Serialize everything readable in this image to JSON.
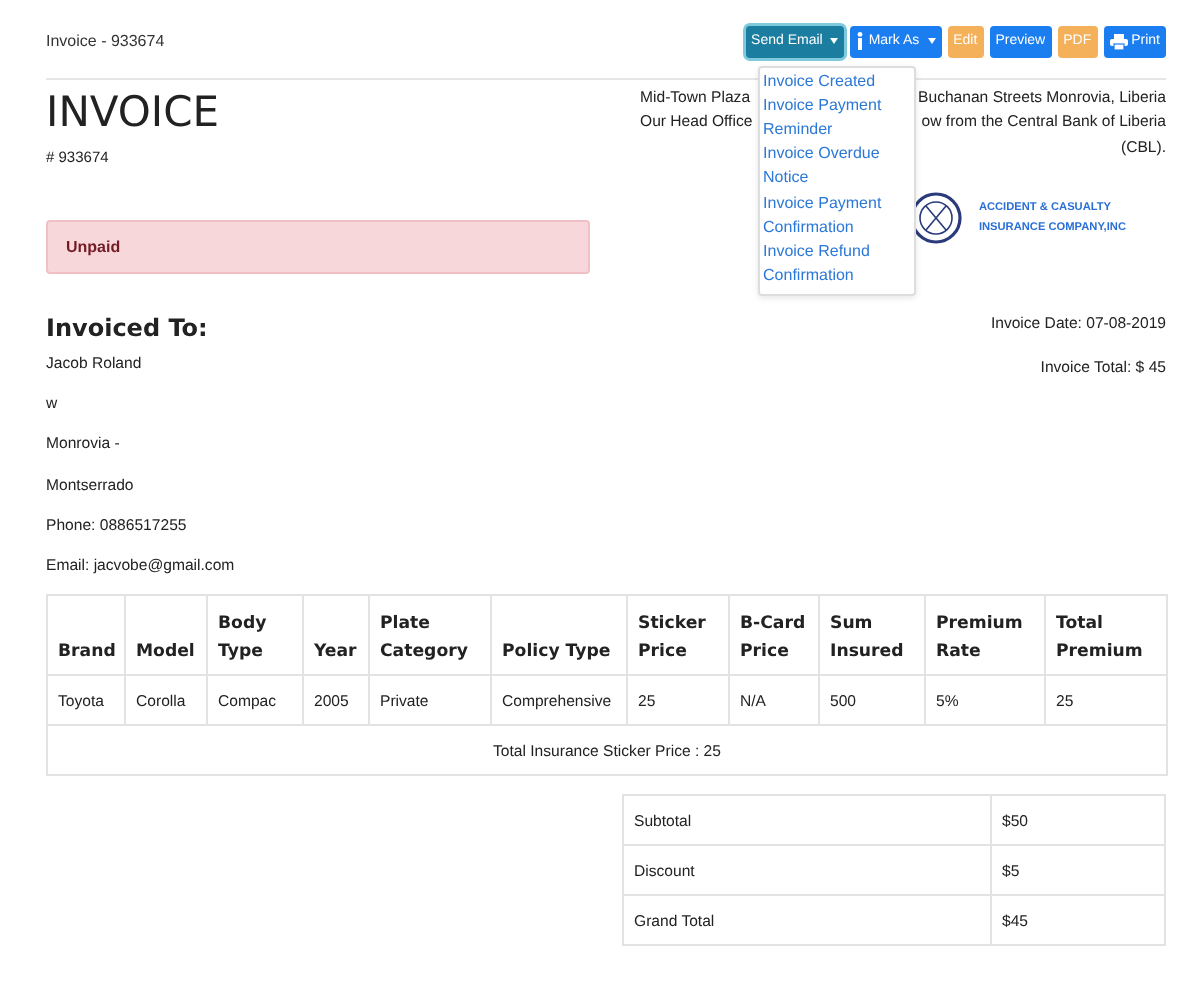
{
  "page_title": "Invoice - 933674",
  "buttons": [
    {
      "label": "Send Email",
      "kind": "menu",
      "expanded": true
    },
    {
      "label": "Mark As",
      "kind": "status-menu",
      "expanded": false
    },
    {
      "label": "Edit",
      "kind": "plain",
      "expanded": false
    },
    {
      "label": "Preview",
      "kind": "plain",
      "expanded": false
    },
    {
      "label": "PDF",
      "kind": "plain",
      "expanded": false
    },
    {
      "label": "Print",
      "kind": "print",
      "expanded": false
    }
  ],
  "email_menu": [
    "Invoice Created",
    "Invoice Payment Reminder",
    "Invoice Overdue Notice",
    "Invoice Payment Confirmation",
    "Invoice Refund Confirmation"
  ],
  "heading": "INVOICE",
  "number": "# 933674",
  "status": "Unpaid",
  "address": [
    {
      "start": "Mid-Town Plaza",
      "end": "Buchanan Streets Monrovia, Liberia"
    },
    {
      "start": "Our Head Office",
      "end": "ow from the Central Bank of Liberia"
    },
    {
      "end": "(CBL)."
    }
  ],
  "company_name": [
    "ACCIDENT & CASUALTY",
    "INSURANCE COMPANY,INC"
  ],
  "invoiced_to": {
    "title": "Invoiced To:",
    "lines": [
      "Jacob Roland",
      "w",
      "Monrovia -",
      "Montserrado",
      "Phone: 0886517255",
      "Email: jacvobe@gmail.com"
    ]
  },
  "invoice_date": "Invoice Date: 07-08-2019",
  "invoice_total": "Invoice Total: $ 45",
  "table": {
    "columns": [
      "Brand",
      "Model",
      "Body Type",
      "Year",
      "Plate Category",
      "Policy Type",
      "Sticker Price",
      "B-Card Price",
      "Sum Insured",
      "Premium Rate",
      "Total Premium"
    ],
    "rows": [
      [
        "Toyota",
        "Corolla",
        "Compac",
        "2005",
        "Private",
        "Comprehensive",
        "25",
        "N/A",
        "500",
        "5%",
        "25"
      ]
    ],
    "footer": "Total Insurance Sticker Price : 25"
  },
  "totals": [
    {
      "label": "Subtotal",
      "value": "$50"
    },
    {
      "label": "Discount",
      "value": "$5"
    },
    {
      "label": "Grand Total",
      "value": "$45"
    }
  ]
}
